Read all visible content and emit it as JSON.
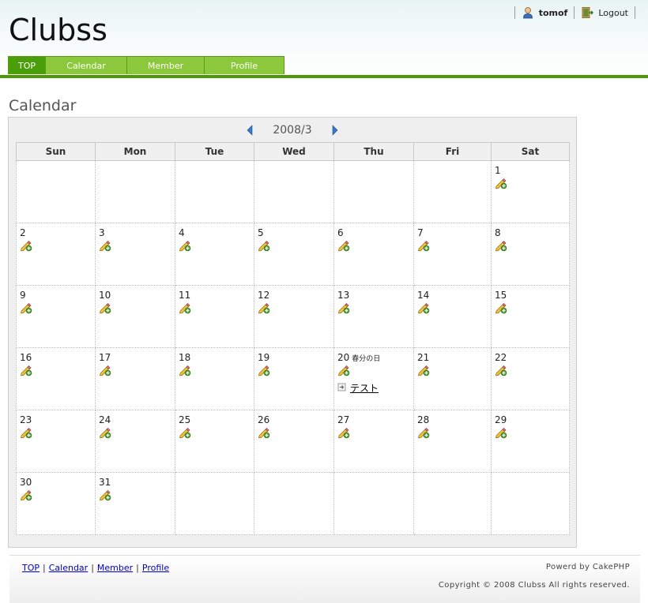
{
  "site": {
    "title": "Clubss"
  },
  "user_bar": {
    "username": "tomof",
    "logout_label": "Logout"
  },
  "tabs": [
    {
      "label": "TOP",
      "active": true
    },
    {
      "label": "Calendar",
      "active": false
    },
    {
      "label": "Member",
      "active": false
    },
    {
      "label": "Profile",
      "active": false
    }
  ],
  "page": {
    "heading": "Calendar"
  },
  "calendar": {
    "month_label": "2008/3",
    "weekdays": [
      "Sun",
      "Mon",
      "Tue",
      "Wed",
      "Thu",
      "Fri",
      "Sat"
    ],
    "first_weekday": 6,
    "days_in_month": 31,
    "holidays": {
      "20": "春分の日"
    },
    "events": {
      "20": [
        "テスト"
      ]
    }
  },
  "footer": {
    "links": [
      "TOP",
      "Calendar",
      "Member",
      "Profile"
    ],
    "powered": "Powerd by CakePHP",
    "copyright": "Copyright © 2008 Clubss All rights reserved."
  },
  "colors": {
    "accent_green": "#4a9a06",
    "tab_green": "#8cc83c"
  },
  "icons": {
    "user": "user-icon",
    "logout": "door-icon",
    "add": "pencil-add-icon",
    "event": "event-bullet-icon",
    "prev": "arrow-left-icon",
    "next": "arrow-right-icon"
  }
}
